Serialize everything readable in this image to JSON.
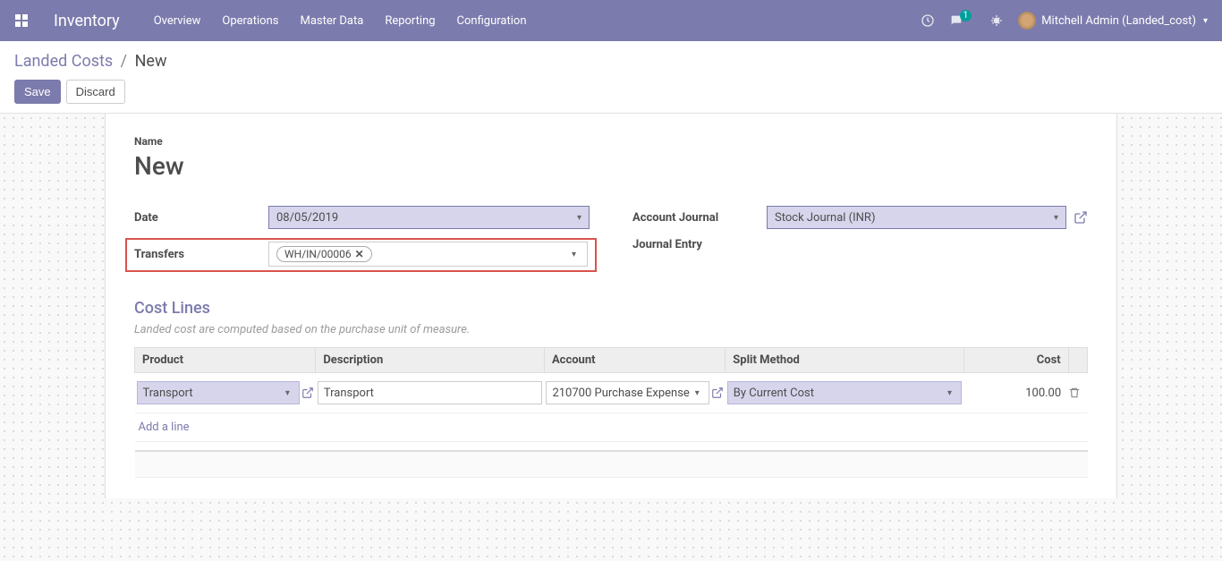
{
  "navbar": {
    "app_title": "Inventory",
    "menu": [
      "Overview",
      "Operations",
      "Master Data",
      "Reporting",
      "Configuration"
    ],
    "chat_count": "1",
    "user_name": "Mitchell Admin (Landed_cost)"
  },
  "breadcrumb": {
    "parent": "Landed Costs",
    "current": "New"
  },
  "buttons": {
    "save": "Save",
    "discard": "Discard"
  },
  "form": {
    "name_label": "Name",
    "name_value": "New",
    "date_label": "Date",
    "date_value": "08/05/2019",
    "transfers_label": "Transfers",
    "transfers_tag": "WH/IN/00006",
    "journal_label": "Account Journal",
    "journal_value": "Stock Journal (INR)",
    "entry_label": "Journal Entry"
  },
  "cost_lines": {
    "title": "Cost Lines",
    "hint": "Landed cost are computed based on the purchase unit of measure.",
    "headers": {
      "product": "Product",
      "description": "Description",
      "account": "Account",
      "split": "Split Method",
      "cost": "Cost"
    },
    "row": {
      "product": "Transport",
      "description": "Transport",
      "account": "210700 Purchase Expense",
      "split": "By Current Cost",
      "cost": "100.00"
    },
    "add_line": "Add a line"
  }
}
